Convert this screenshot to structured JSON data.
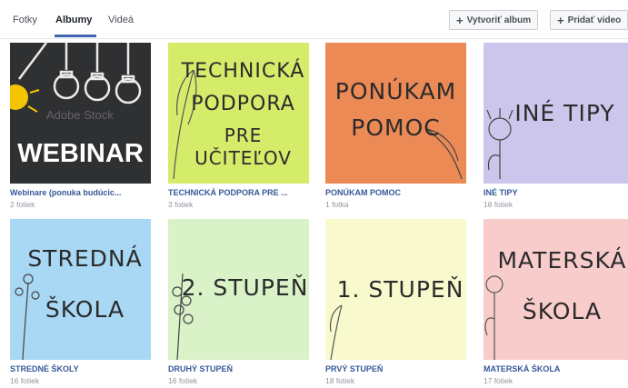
{
  "tabs": [
    {
      "label": "Fotky"
    },
    {
      "label": "Albumy"
    },
    {
      "label": "Videá"
    }
  ],
  "buttons": {
    "create_album": "Vytvoriť album",
    "add_video": "Pridať video"
  },
  "albums": [
    {
      "title": "Webinare (ponuka budúcic...",
      "count": "2 fotiek",
      "cover_text": [
        "WEBINAR"
      ],
      "watermark": "Adobe Stock",
      "bg": "#2f3032"
    },
    {
      "title": "TECHNICKÁ PODPORA PRE ...",
      "count": "3 fotiek",
      "cover_text": [
        "TECHNICKÁ",
        "PODPORA",
        "PRE UČITEĽOV"
      ],
      "bg": "#d5ec6a"
    },
    {
      "title": "PONÚKAM POMOC",
      "count": "1 fotka",
      "cover_text": [
        "PONÚKAM",
        "POMOC"
      ],
      "bg": "#ec8a56"
    },
    {
      "title": "INÉ TIPY",
      "count": "18 fotiek",
      "cover_text": [
        "INÉ TIPY"
      ],
      "bg": "#ccc6ec"
    },
    {
      "title": "STREDNÉ ŠKOLY",
      "count": "16 fotiek",
      "cover_text": [
        "STREDNÁ",
        "ŠKOLA"
      ],
      "bg": "#a8d8f4"
    },
    {
      "title": "DRUHÝ STUPEŇ",
      "count": "16 fotiek",
      "cover_text": [
        "2. STUPEŇ"
      ],
      "bg": "#d9f2c8"
    },
    {
      "title": "PRVÝ STUPEŇ",
      "count": "18 fotiek",
      "cover_text": [
        "1. STUPEŇ"
      ],
      "bg": "#f8f9cc"
    },
    {
      "title": "MATERSKÁ ŠKOLA",
      "count": "17 fotiek",
      "cover_text": [
        "MATERSKÁ",
        "ŠKOLA"
      ],
      "bg": "#f9cccc"
    }
  ],
  "colors": {
    "link": "#365899",
    "meta": "#90949c",
    "accent": "#4267b2"
  }
}
